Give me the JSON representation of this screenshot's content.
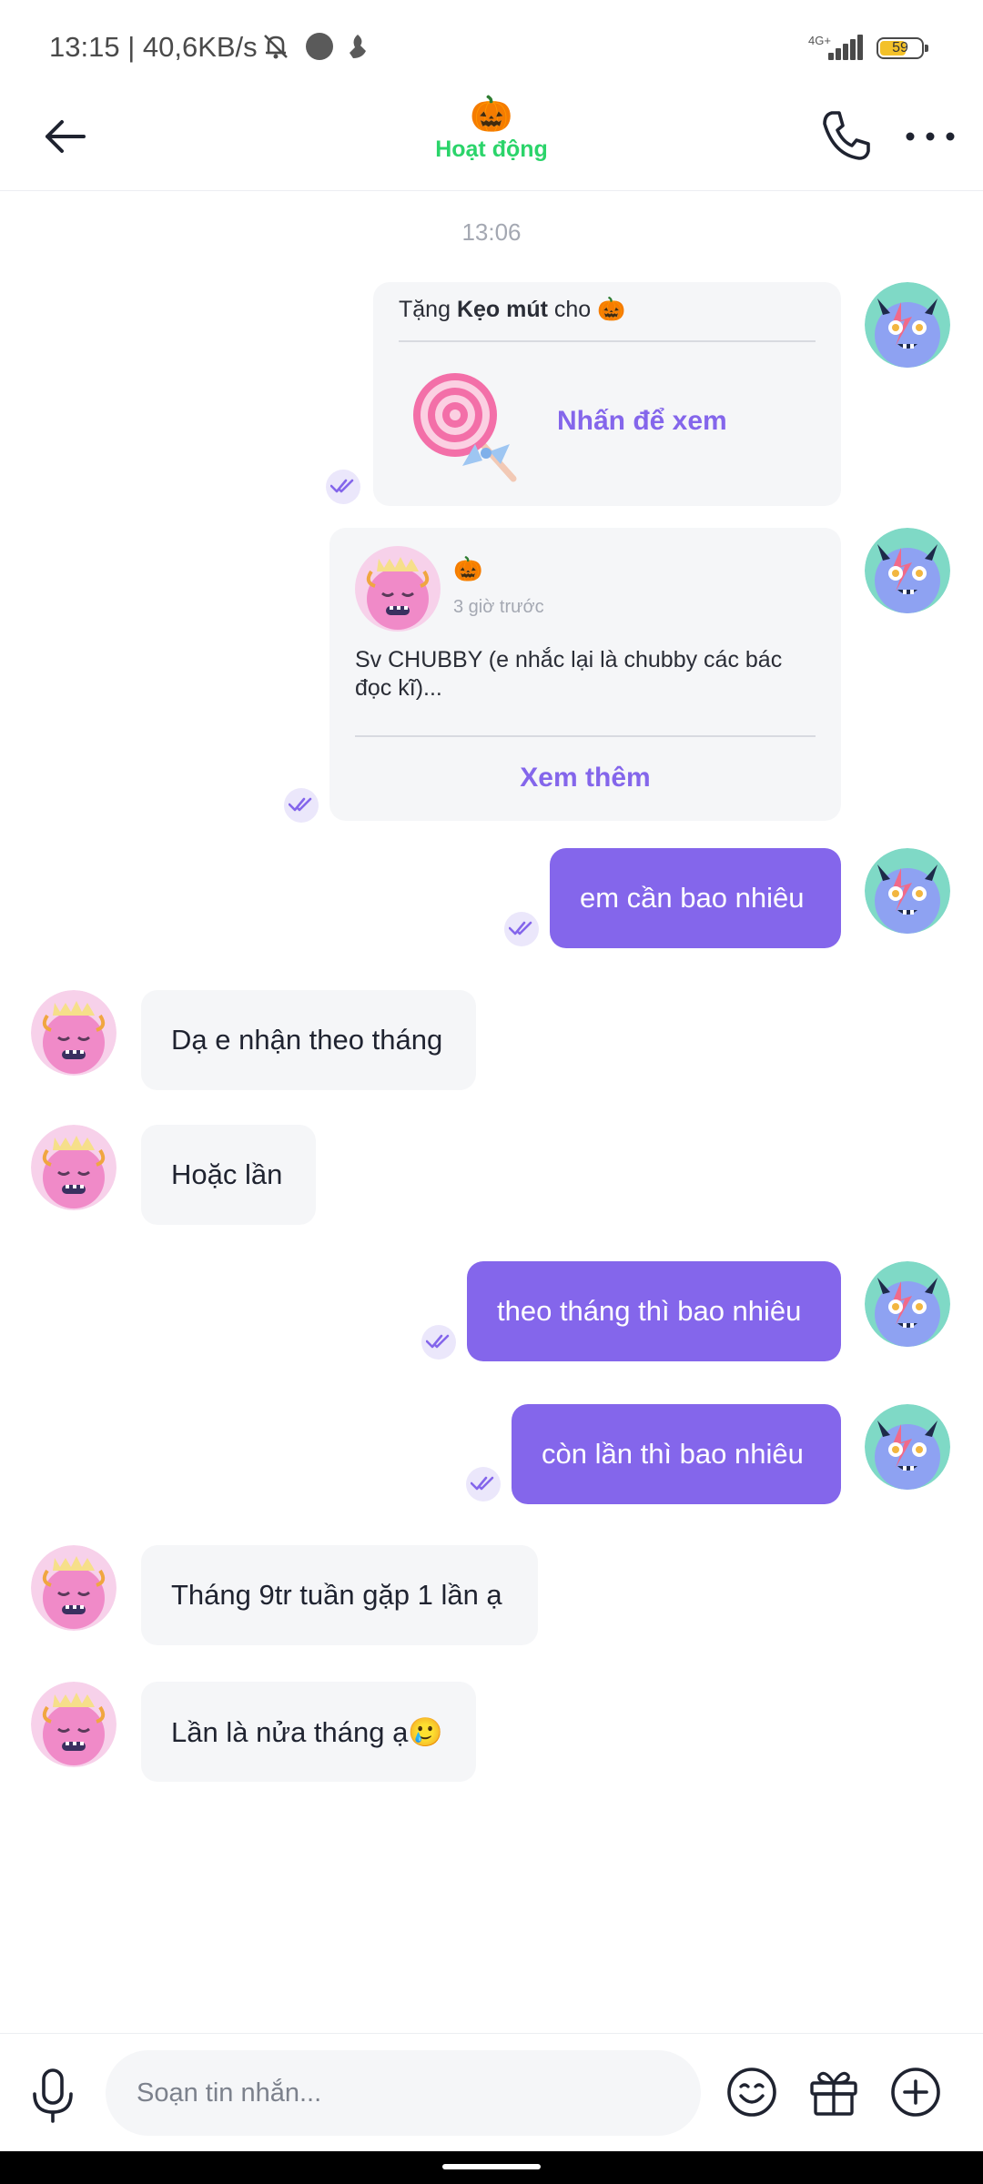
{
  "status_bar": {
    "text": "13:15 | 40,6KB/s",
    "network": "4G+",
    "battery_level": "59"
  },
  "header": {
    "title_emoji": "🎃",
    "status": "Hoạt động"
  },
  "chat": {
    "timestamp": "13:06",
    "gift_card": {
      "prefix": "Tặng ",
      "gift_name": "Kẹo mút",
      "suffix": " cho 🎃",
      "action": "Nhấn để xem"
    },
    "post_card": {
      "author_emoji": "🎃",
      "time_ago": "3 giờ trước",
      "text": "Sv CHUBBY (e nhắc lại là chubby các bác đọc kĩ)...",
      "more": "Xem thêm"
    },
    "messages": [
      {
        "direction": "out",
        "text": "em cần bao nhiêu"
      },
      {
        "direction": "in",
        "text": "Dạ e nhận theo tháng"
      },
      {
        "direction": "in",
        "text": "Hoặc lần"
      },
      {
        "direction": "out",
        "text": "theo tháng thì bao nhiêu"
      },
      {
        "direction": "out",
        "text": "còn lần thì bao nhiêu"
      },
      {
        "direction": "in",
        "text": "Tháng 9tr tuần gặp 1 lần ạ"
      },
      {
        "direction": "in",
        "text": "Lần là nửa tháng ạ🥲"
      }
    ]
  },
  "composer": {
    "placeholder": "Soạn tin nhắn..."
  },
  "colors": {
    "accent": "#8466eb",
    "online": "#2bd46a",
    "incoming_bubble": "#f5f6f8"
  }
}
